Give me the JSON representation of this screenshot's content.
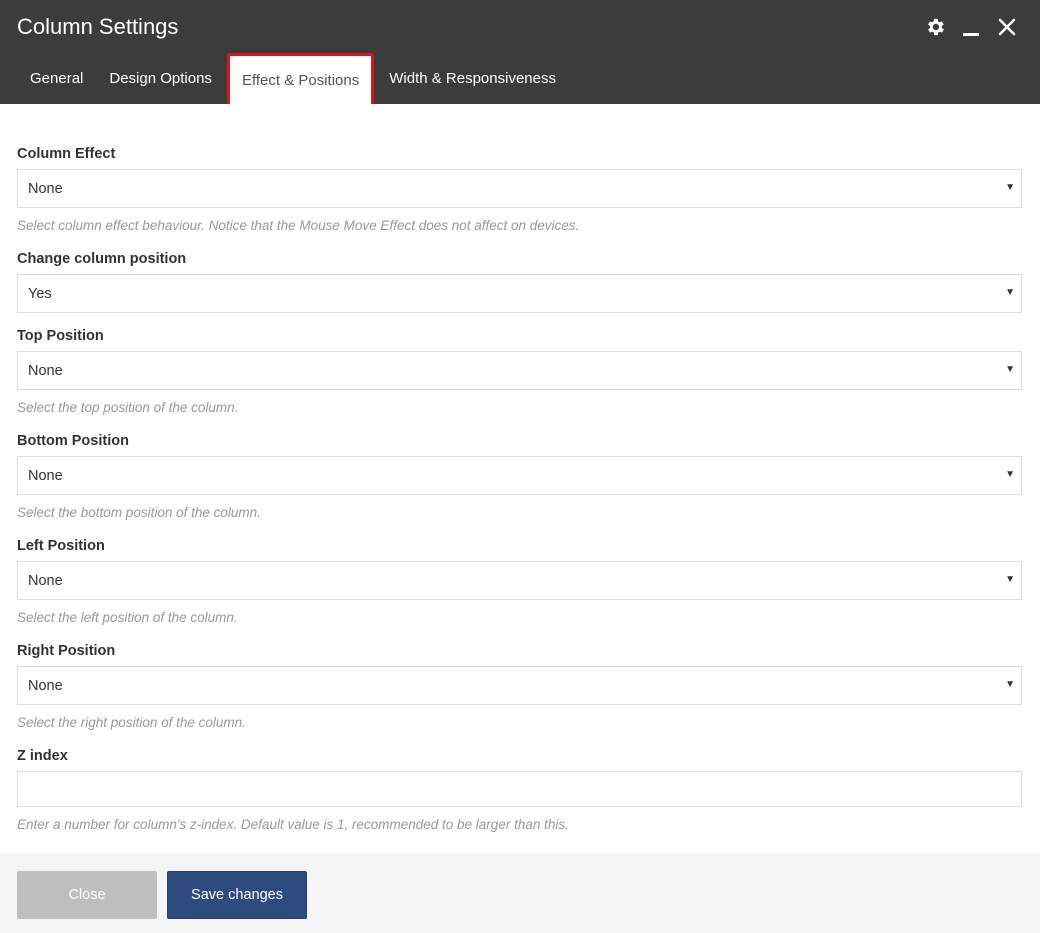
{
  "window": {
    "title": "Column Settings",
    "icons": [
      "gear-icon",
      "minimize-icon",
      "close-icon"
    ]
  },
  "tabs": [
    {
      "label": "General"
    },
    {
      "label": "Design Options"
    },
    {
      "label": "Effect & Positions",
      "active": true
    },
    {
      "label": "Width & Responsiveness"
    }
  ],
  "fields": {
    "column_effect": {
      "label": "Column Effect",
      "value": "None",
      "hint": "Select column effect behaviour. Notice that the Mouse Move Effect does not affect on devices."
    },
    "change_position": {
      "label": "Change column position",
      "value": "Yes"
    },
    "top_position": {
      "label": "Top Position",
      "value": "None",
      "hint": "Select the top position of the column."
    },
    "bottom_position": {
      "label": "Bottom Position",
      "value": "None",
      "hint": "Select the bottom position of the column."
    },
    "left_position": {
      "label": "Left Position",
      "value": "None",
      "hint": "Select the left position of the column."
    },
    "right_position": {
      "label": "Right Position",
      "value": "None",
      "hint": "Select the right position of the column."
    },
    "z_index": {
      "label": "Z index",
      "value": "",
      "hint": "Enter a number for column's z-index. Default value is 1, recommended to be larger than this."
    }
  },
  "footer": {
    "close_label": "Close",
    "save_label": "Save changes"
  },
  "colors": {
    "header_bg": "#3c3c3c",
    "active_tab_border": "#e0131a",
    "save_button": "#2e4b80",
    "close_button": "#bfbfbf"
  }
}
